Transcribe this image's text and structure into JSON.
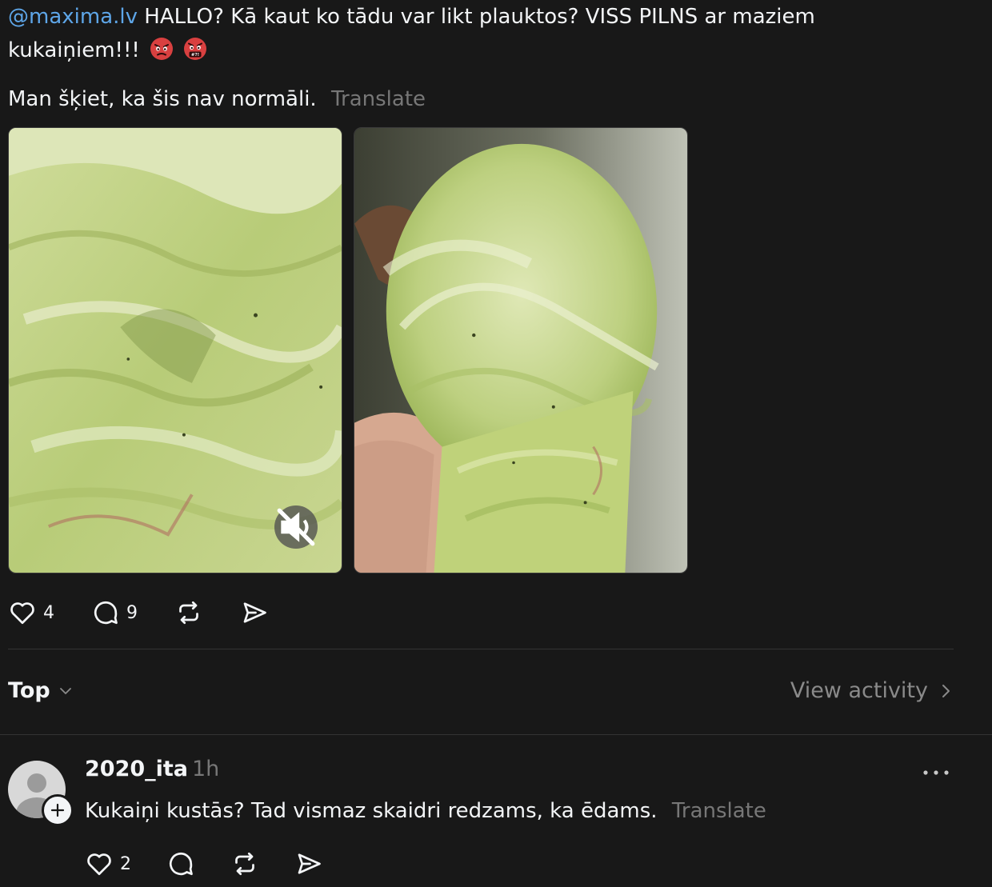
{
  "post": {
    "mention": "@maxima.lv",
    "text_line1": " HALLO? Kā kaut ko tādu var likt plauktos? VISS PILNS ar maziem",
    "text_line2": "kukaiņiem!!!",
    "emojis": [
      "angry-face",
      "cursing-face"
    ],
    "text_2": "Man šķiet, ka šis nav normāli.",
    "translate_label": "Translate",
    "media": [
      {
        "type": "video",
        "subject": "iceberg lettuce close-up",
        "muted": true
      },
      {
        "type": "image",
        "subject": "iceberg lettuce held in hand"
      }
    ],
    "actions": {
      "likes": "4",
      "comments": "9"
    }
  },
  "sort": {
    "label": "Top",
    "view_activity_label": "View activity"
  },
  "reply": {
    "username": "2020_ita",
    "time": "1h",
    "text": "Kukaiņi kustās? Tad vismaz skaidri redzams, ka ēdams.",
    "translate_label": "Translate",
    "actions": {
      "likes": "2"
    }
  },
  "colors": {
    "background": "#181818",
    "text": "#f3f5f7",
    "muted": "#777777",
    "mention": "#5ea6e8",
    "divider": "#333333"
  },
  "icons": [
    "heart-icon",
    "comment-icon",
    "repost-icon",
    "share-icon",
    "mute-icon",
    "chevron-down-icon",
    "chevron-right-icon",
    "more-icon",
    "plus-icon"
  ]
}
